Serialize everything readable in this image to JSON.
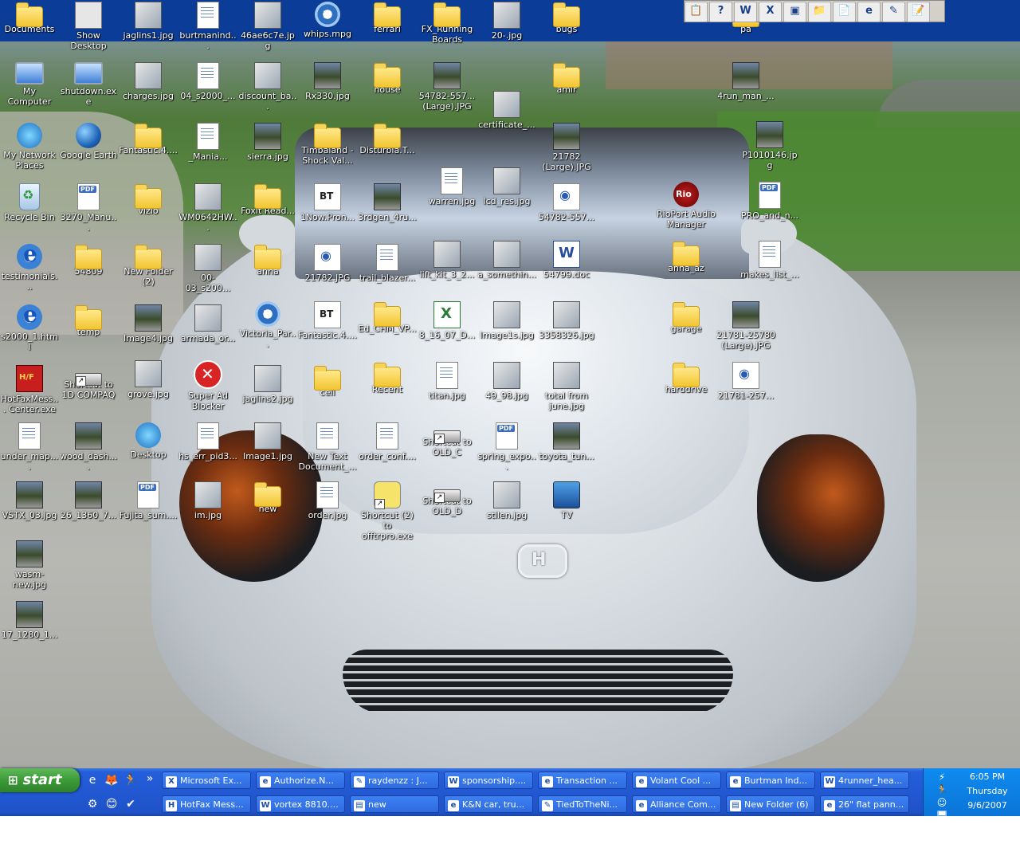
{
  "icons": [
    {
      "label": "Documents",
      "type": "folder"
    },
    {
      "label": "Show Desktop",
      "type": "exe"
    },
    {
      "label": "jaglins1.jpg",
      "type": "img"
    },
    {
      "label": "burtmanind...",
      "type": "doc"
    },
    {
      "label": "46ae6c7e.jpg",
      "type": "img"
    },
    {
      "label": "whips.mpg",
      "type": "media"
    },
    {
      "label": "ferrari",
      "type": "folder"
    },
    {
      "label": "FX_Running Boards",
      "type": "folder"
    },
    {
      "label": "20-.jpg",
      "type": "img"
    },
    {
      "label": "bugs",
      "type": "folder"
    },
    {
      "label": "pa",
      "type": "folder"
    },
    {
      "label": "My Computer",
      "type": "pc"
    },
    {
      "label": "shutdown.exe",
      "type": "pc"
    },
    {
      "label": "charges.jpg",
      "type": "img"
    },
    {
      "label": "04_s2000_...",
      "type": "doc"
    },
    {
      "label": "discount_ba...",
      "type": "img"
    },
    {
      "label": "Rx330.jpg",
      "type": "photo"
    },
    {
      "label": "house",
      "type": "folder"
    },
    {
      "label": "54782-557... (Large).JPG",
      "type": "photo"
    },
    {
      "label": "amir",
      "type": "folder"
    },
    {
      "label": "4run_man_...",
      "type": "photo"
    },
    {
      "label": "certificate_...",
      "type": "img"
    },
    {
      "label": "My Network Places",
      "type": "net"
    },
    {
      "label": "Google Earth",
      "type": "earth"
    },
    {
      "label": "Fantastic.4....",
      "type": "folder"
    },
    {
      "label": "_Mania...",
      "type": "doc"
    },
    {
      "label": "sierra.jpg",
      "type": "photo"
    },
    {
      "label": "Timbaland - Shock Val...",
      "type": "folder"
    },
    {
      "label": "Disturbia.T...",
      "type": "folder"
    },
    {
      "label": "21782 (Large).JPG",
      "type": "photo"
    },
    {
      "label": "P1010146.jpg",
      "type": "photo"
    },
    {
      "label": "warren.jpg",
      "type": "doc"
    },
    {
      "label": "lcd_res.jpg",
      "type": "img"
    },
    {
      "label": "Recycle Bin",
      "type": "bin"
    },
    {
      "label": "3270_Manu...",
      "type": "pdf"
    },
    {
      "label": "vizio",
      "type": "folder"
    },
    {
      "label": "WM0642HW...",
      "type": "img"
    },
    {
      "label": "Foxit Read...",
      "type": "folder"
    },
    {
      "label": "1Now.Pron...",
      "type": "bt"
    },
    {
      "label": "3rdgen_4ru...",
      "type": "photo"
    },
    {
      "label": "54782-557...",
      "type": "eye"
    },
    {
      "label": "RioPort Audio Manager",
      "type": "rio"
    },
    {
      "label": "PRO_and_n...",
      "type": "pdf"
    },
    {
      "label": "testimonials...",
      "type": "ie"
    },
    {
      "label": "54809",
      "type": "folder"
    },
    {
      "label": "New Folder (2)",
      "type": "folder"
    },
    {
      "label": "00-03_s200...",
      "type": "img"
    },
    {
      "label": "anna",
      "type": "folder"
    },
    {
      "label": "21782.JPG",
      "type": "eye"
    },
    {
      "label": "trail_blazer...",
      "type": "doc"
    },
    {
      "label": "lift_kit_3_2...",
      "type": "img"
    },
    {
      "label": "a_somethin...",
      "type": "img"
    },
    {
      "label": "54799.doc",
      "type": "word"
    },
    {
      "label": "anna_az",
      "type": "folder"
    },
    {
      "label": "makes_list_...",
      "type": "doc"
    },
    {
      "label": "s2000_1.html",
      "type": "ie"
    },
    {
      "label": "temp",
      "type": "folder"
    },
    {
      "label": "Image4.jpg",
      "type": "photo"
    },
    {
      "label": "armada_or...",
      "type": "img"
    },
    {
      "label": "Victoria_Par...",
      "type": "media"
    },
    {
      "label": "Fantastic.4....",
      "type": "bt"
    },
    {
      "label": "Ed_CHM_VP...",
      "type": "folder"
    },
    {
      "label": "8_16_07_D...",
      "type": "xls"
    },
    {
      "label": "Image1s.jpg",
      "type": "img"
    },
    {
      "label": "3358326.jpg",
      "type": "img"
    },
    {
      "label": "garage",
      "type": "folder"
    },
    {
      "label": "21781-25780 (Large).JPG",
      "type": "photo"
    },
    {
      "label": "HotFaxMess... Center.exe",
      "type": "hotfax"
    },
    {
      "label": "Shortcut to 1D COMPAQ",
      "type": "drive"
    },
    {
      "label": "grove.jpg",
      "type": "img"
    },
    {
      "label": "Super Ad Blocker",
      "type": "x"
    },
    {
      "label": "jaglins2.jpg",
      "type": "img"
    },
    {
      "label": "cell",
      "type": "folder"
    },
    {
      "label": "Recent",
      "type": "folder"
    },
    {
      "label": "titan.jpg",
      "type": "doc"
    },
    {
      "label": "49_98.jpg",
      "type": "img"
    },
    {
      "label": "total from june.jpg",
      "type": "img"
    },
    {
      "label": "harddrive",
      "type": "folder"
    },
    {
      "label": "21781-257...",
      "type": "eye"
    },
    {
      "label": "under_map....",
      "type": "doc"
    },
    {
      "label": "wood_dash....",
      "type": "photo"
    },
    {
      "label": "Desktop",
      "type": "net"
    },
    {
      "label": "hs_err_pid3...",
      "type": "doc"
    },
    {
      "label": "Image1.jpg",
      "type": "img"
    },
    {
      "label": "New Text Document_...",
      "type": "doc"
    },
    {
      "label": "order_conf....",
      "type": "doc"
    },
    {
      "label": "Shortcut to OLD_C",
      "type": "drive"
    },
    {
      "label": "spring_expo...",
      "type": "pdf"
    },
    {
      "label": "toyota_tun...",
      "type": "photo"
    },
    {
      "label": "VSTX_03.jpg",
      "type": "photo"
    },
    {
      "label": "26_1360_7...",
      "type": "photo"
    },
    {
      "label": "Fujita_sum....",
      "type": "pdf"
    },
    {
      "label": "im.jpg",
      "type": "img"
    },
    {
      "label": "new",
      "type": "folder"
    },
    {
      "label": "order.jpg",
      "type": "doc"
    },
    {
      "label": "Shortcut (2) to offtrpro.exe",
      "type": "cartoon"
    },
    {
      "label": "Shortcut to OLD_D",
      "type": "drive"
    },
    {
      "label": "stilen.jpg",
      "type": "img"
    },
    {
      "label": "TV",
      "type": "tv"
    },
    {
      "label": "wasm-new.jpg",
      "type": "photo"
    },
    {
      "label": "17_1280_1...",
      "type": "photo"
    }
  ],
  "quicklaunch_top": [
    "📋",
    "?",
    "W",
    "X",
    "▣",
    "📁",
    "📄",
    "e",
    "✎",
    "📝"
  ],
  "taskbar": {
    "start_label": "start",
    "quicklaunch": [
      "e",
      "🦊",
      "🏃",
      "»",
      "⚙",
      "😊",
      "✔"
    ],
    "tasks": [
      {
        "label": "Microsoft Ex...",
        "icon": "X"
      },
      {
        "label": "Authorize.N...",
        "icon": "e"
      },
      {
        "label": "raydenzz : J...",
        "icon": "✎"
      },
      {
        "label": "sponsorship....",
        "icon": "W"
      },
      {
        "label": "Transaction ...",
        "icon": "e"
      },
      {
        "label": "Volant Cool ...",
        "icon": "e"
      },
      {
        "label": "Burtman Ind...",
        "icon": "e"
      },
      {
        "label": "4runner_hea...",
        "icon": "W"
      },
      {
        "label": "HotFax Mess...",
        "icon": "H"
      },
      {
        "label": "vortex 8810....",
        "icon": "W"
      },
      {
        "label": "new",
        "icon": "▤"
      },
      {
        "label": "K&N car, tru...",
        "icon": "e"
      },
      {
        "label": "TiedToTheNi...",
        "icon": "✎"
      },
      {
        "label": "Alliance Com...",
        "icon": "e"
      },
      {
        "label": "New Folder (6)",
        "icon": "▤"
      },
      {
        "label": "26\" flat pann...",
        "icon": "e"
      }
    ],
    "tray_icons": [
      "⚡",
      "🏃",
      "☺",
      "🖥",
      "♻",
      "◆"
    ],
    "clock": {
      "time": "6:05 PM",
      "day": "Thursday",
      "date": "9/6/2007"
    }
  }
}
